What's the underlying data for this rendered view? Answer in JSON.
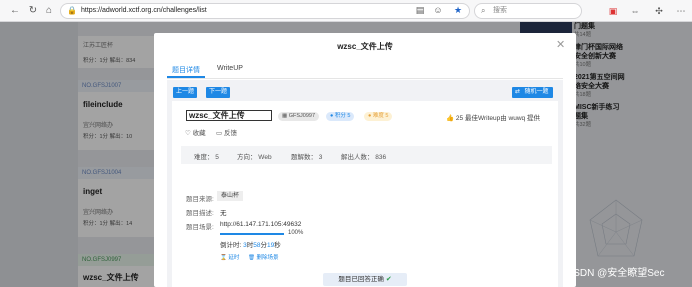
{
  "browser": {
    "url": "https://adworld.xctf.org.cn/challenges/list",
    "search_placeholder": "搜索"
  },
  "background": {
    "cards": [
      {
        "tag": "",
        "title": "江苏工匠杯",
        "sub": "",
        "meta": "积分：1分    解出：834"
      },
      {
        "tag": "NO.GFSJ1007",
        "title": "fileinclude",
        "sub": "宜兴网络办",
        "meta": "积分：1分    解出：10"
      },
      {
        "tag": "NO.GFSJ1004",
        "title": "inget",
        "sub": "宜兴网络办",
        "meta": "积分：1分    解出：14"
      },
      {
        "tag": "NO.GFSJ0997",
        "title": "wzsc_文件上传",
        "sub": "",
        "meta": ""
      }
    ],
    "right_list": [
      {
        "title": "门题集",
        "count": "共14题"
      },
      {
        "title": "津门杯国际网络安全创新大赛",
        "count": "共10题"
      },
      {
        "title": "2021第五空间网络安全大赛",
        "count": "共18题"
      },
      {
        "title": "MISC新手练习题集",
        "count": "共32题"
      }
    ],
    "watermark": "CSDN @安全瞭望Sec"
  },
  "modal": {
    "title": "wzsc_文件上传",
    "tabs": [
      "题目详情",
      "WriteUP"
    ],
    "prev_label": "上一题",
    "next_label": "下一题",
    "random_label": "随机一题",
    "challenge_title": "wzsc_文件上传",
    "code": "GFSJ0997",
    "score_label": "积分 5",
    "difficulty_label": "难度 5",
    "writeup_info": "25 最佳Writeup由 wuwq 提供",
    "like_count": "25",
    "favorite_label": "收藏",
    "feedback_label": "反馈",
    "stats": {
      "difficulty": "难度：  5",
      "direction": "方向：  Web",
      "solves_count": "题解数：  3",
      "solvers": "解出人数：  836"
    },
    "source_label": "题目来源:",
    "source_value": "泰山杯",
    "desc_label": "题目描述:",
    "desc_value": "无",
    "env_label": "题目场景:",
    "env_value": "http://61.147.171.105:49632",
    "progress_text": "100%",
    "progress_value": 1.0,
    "countdown_prefix": "倒计时:",
    "countdown_h": "3",
    "countdown_m": "58",
    "countdown_s": "19",
    "delay_label": "延时",
    "delete_label": "删除场景",
    "solved_label": "题目已回答正确"
  },
  "colors": {
    "accent": "#1e88e5",
    "success": "#2e9d4d",
    "overlay": "rgba(0,0,0,0.36)"
  }
}
